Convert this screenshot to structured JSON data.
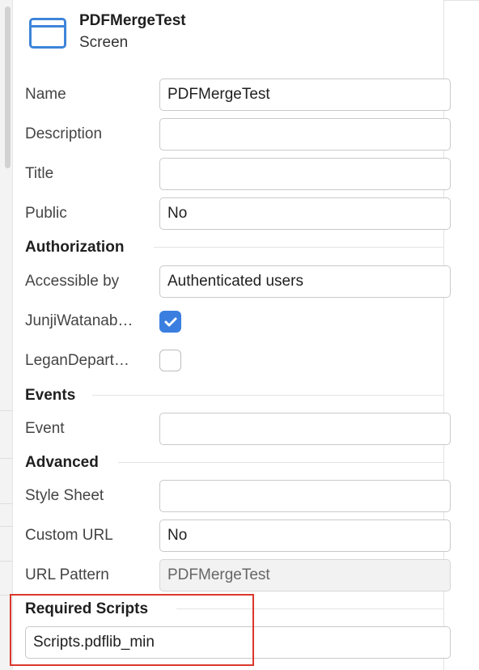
{
  "header": {
    "title": "PDFMergeTest",
    "subtitle": "Screen",
    "icon": "screen-window-icon"
  },
  "properties": {
    "name": {
      "label": "Name",
      "value": "PDFMergeTest"
    },
    "description": {
      "label": "Description",
      "value": ""
    },
    "title": {
      "label": "Title",
      "value": ""
    },
    "public": {
      "label": "Public",
      "value": "No"
    }
  },
  "authorization": {
    "section_title": "Authorization",
    "accessible_by": {
      "label": "Accessible by",
      "value": "Authenticated users"
    },
    "roles": [
      {
        "label": "JunjiWatanab…",
        "checked": true
      },
      {
        "label": "LeganDepart…",
        "checked": false
      }
    ]
  },
  "events": {
    "section_title": "Events",
    "event": {
      "label": "Event",
      "value": ""
    }
  },
  "advanced": {
    "section_title": "Advanced",
    "style_sheet": {
      "label": "Style Sheet",
      "value": ""
    },
    "custom_url": {
      "label": "Custom URL",
      "value": "No"
    },
    "url_pattern": {
      "label": "URL Pattern",
      "value": "PDFMergeTest"
    }
  },
  "required_scripts": {
    "section_title": "Required Scripts",
    "value": "Scripts.pdflib_min"
  },
  "colors": {
    "accent": "#3e84d9",
    "checkbox_checked": "#3a7fe0",
    "highlight": "#d9372b"
  }
}
